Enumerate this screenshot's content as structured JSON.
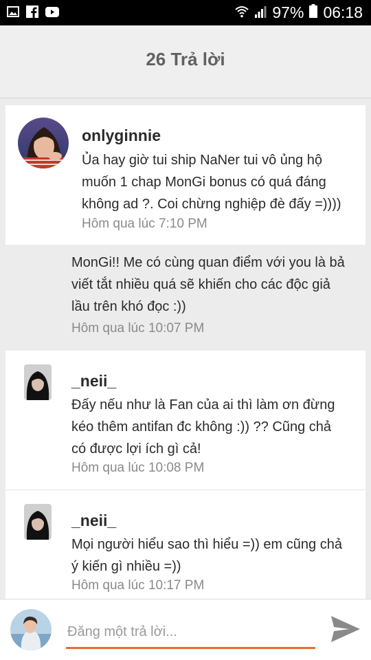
{
  "status_bar": {
    "battery": "97%",
    "time": "06:18",
    "left_icons": [
      "image-icon",
      "facebook-icon",
      "youtube-icon"
    ],
    "right_icons": [
      "wifi-icon",
      "signal-icon",
      "battery-icon"
    ]
  },
  "header": {
    "title": "26 Trả lời"
  },
  "comments": [
    {
      "author": "onlyginnie",
      "text_lines": [
        "Ủa hay giờ tui ship NaNer tui vô ủng hộ",
        "muốn 1 chap MonGi bonus có quá đáng",
        "không ad ?. Coi chừng nghiệp đè đấy =))))"
      ],
      "time": "Hôm qua lúc 7:10 PM"
    },
    {
      "author": "",
      "text_lines": [
        "MonGi!! Me có cùng quan điểm với you là bả",
        "viết tắt nhiều quá sẽ khiến cho các độc giả",
        "lầu trên khó đọc :))"
      ],
      "time": "Hôm qua lúc 10:07 PM"
    },
    {
      "author": "_neii_",
      "text_lines": [
        "Đấy nếu như là Fan của ai thì làm ơn đừng",
        "kéo thêm antifan đc không :)) ?? Cũng chả",
        "có được lợi ích gì cả!"
      ],
      "time": "Hôm qua lúc 10:08 PM"
    },
    {
      "author": "_neii_",
      "text_lines": [
        "Mọi người hiểu sao thì hiểu =)) em cũng chả",
        "ý kiến gì nhiều =))"
      ],
      "time": "Hôm qua lúc 10:17 PM"
    }
  ],
  "composer": {
    "placeholder": "Đăng một trả lời..."
  },
  "colors": {
    "accent": "#ea6b2e",
    "header_text": "#616161",
    "meta_text": "#8a8a8a"
  }
}
